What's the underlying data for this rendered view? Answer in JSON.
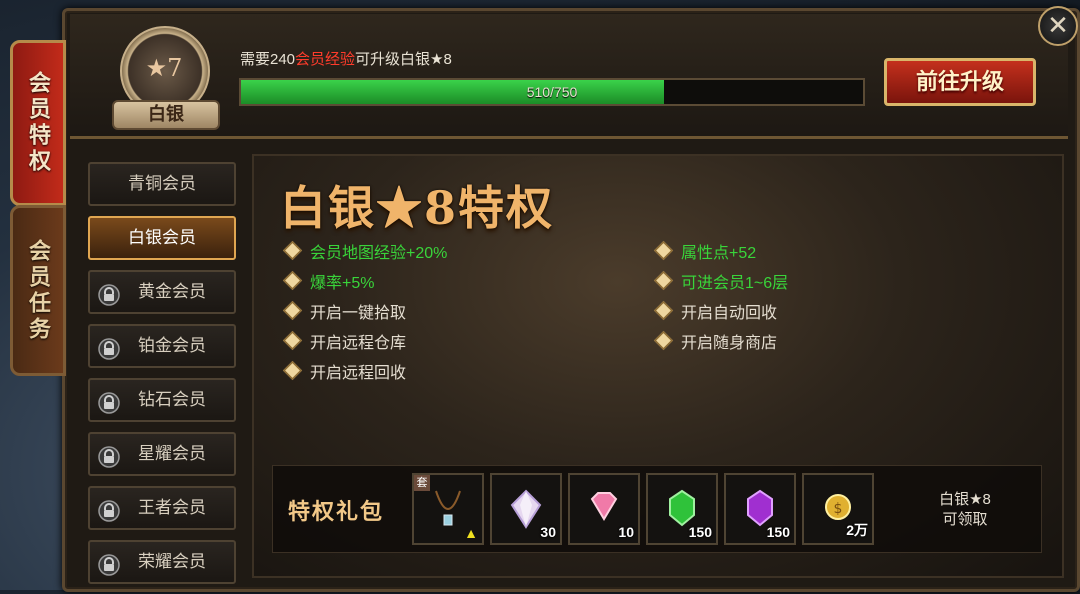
{
  "side_tabs": {
    "privilege": "会员特权",
    "task": "会员任务"
  },
  "header": {
    "badge_stars": "★7",
    "badge_rank": "白银",
    "upgrade_prefix": "需要240",
    "upgrade_highlight": "会员经验",
    "upgrade_suffix": "可升级白银★8",
    "progress_current": 510,
    "progress_max": 750,
    "progress_text": "510/750",
    "progress_fraction": 0.68,
    "go_upgrade_label": "前往升级",
    "close_symbol": "✕"
  },
  "tiers": [
    {
      "label": "青铜会员",
      "locked": false,
      "active": false
    },
    {
      "label": "白银会员",
      "locked": false,
      "active": true
    },
    {
      "label": "黄金会员",
      "locked": true,
      "active": false
    },
    {
      "label": "铂金会员",
      "locked": true,
      "active": false
    },
    {
      "label": "钻石会员",
      "locked": true,
      "active": false
    },
    {
      "label": "星耀会员",
      "locked": true,
      "active": false
    },
    {
      "label": "王者会员",
      "locked": true,
      "active": false
    },
    {
      "label": "荣耀会员",
      "locked": true,
      "active": false
    }
  ],
  "main": {
    "title": "白银★8特权",
    "benefits_left": [
      {
        "text": "会员地图经验+20%",
        "green": true
      },
      {
        "text": "爆率+5%",
        "green": true
      },
      {
        "text": "开启一键拾取",
        "green": false
      },
      {
        "text": "开启远程仓库",
        "green": false
      },
      {
        "text": "开启远程回收",
        "green": false
      }
    ],
    "benefits_right": [
      {
        "text": "属性点+52",
        "green": true
      },
      {
        "text": "可进会员1~6层",
        "green": true
      },
      {
        "text": "开启自动回收",
        "green": false
      },
      {
        "text": "开启随身商店",
        "green": false
      }
    ]
  },
  "gift": {
    "title": "特权礼包",
    "items": [
      {
        "icon": "necklace-icon",
        "qty": "",
        "tag": "套"
      },
      {
        "icon": "white-crystal-icon",
        "qty": "30"
      },
      {
        "icon": "pink-diamond-icon",
        "qty": "10"
      },
      {
        "icon": "green-gem-icon",
        "qty": "150"
      },
      {
        "icon": "purple-gem-icon",
        "qty": "150"
      },
      {
        "icon": "gold-coin-icon",
        "qty": "2万"
      }
    ],
    "status_line1": "白银★8",
    "status_line2": "可领取"
  },
  "colors": {
    "accent_gold": "#f0b46a",
    "progress_green": "#3ad24a",
    "highlight_red": "#ff3b2b",
    "benefit_green": "#39d43a"
  }
}
